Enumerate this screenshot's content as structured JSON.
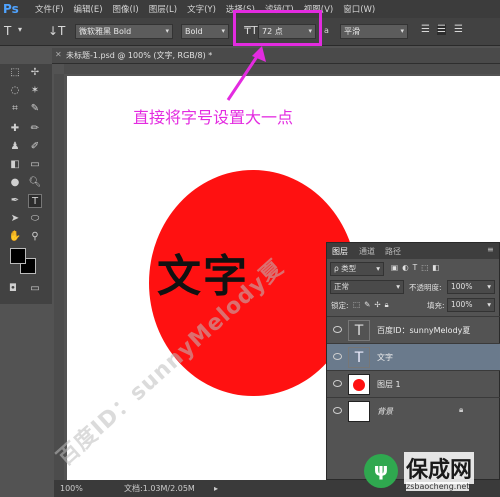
{
  "app": {
    "logo": "Ps"
  },
  "menu": [
    "文件(F)",
    "编辑(E)",
    "图像(I)",
    "图层(L)",
    "文字(Y)",
    "选择(S)",
    "滤镜(T)",
    "视图(V)",
    "窗口(W)"
  ],
  "options": {
    "font_family": "微软雅黑 Bold",
    "font_style": "Bold",
    "font_size": "72 点",
    "aa_prefix": "a",
    "antialias": "平滑"
  },
  "document": {
    "tab_title": "未标题-1.psd @ 100% (文字, RGB/8) *",
    "zoom": "100%",
    "doc_info": "文档:1.03M/2.05M"
  },
  "canvas": {
    "big_text": "文字",
    "annotation": "直接将字号设置大一点",
    "watermark": "百度ID：sunnyMelody夏"
  },
  "layers_panel": {
    "tabs": [
      "图层",
      "通道",
      "路径"
    ],
    "kind_label": "ρ 类型",
    "blend_mode": "正常",
    "opacity_label": "不透明度:",
    "opacity_value": "100%",
    "lock_label": "锁定:",
    "fill_label": "填充:",
    "fill_value": "100%",
    "layers": [
      {
        "name": "百度ID：sunnyMelody夏",
        "kind": "type",
        "selected": false
      },
      {
        "name": "文字",
        "kind": "type",
        "selected": true
      },
      {
        "name": "图层 1",
        "kind": "pixel-red-dot",
        "selected": false
      },
      {
        "name": "背景",
        "kind": "background",
        "selected": false
      }
    ]
  },
  "site_logo": {
    "name": "保成网",
    "url_text": "zsbaocheng.net"
  },
  "colors": {
    "highlight": "#e32be0",
    "circle": "#ff1111",
    "selected_layer": "#6a7a8c"
  }
}
